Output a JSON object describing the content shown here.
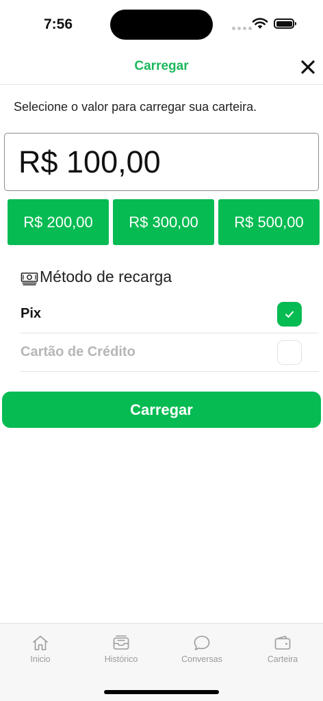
{
  "status_bar": {
    "time": "7:56"
  },
  "header": {
    "title": "Carregar",
    "close_icon": "close-x-icon"
  },
  "instruction": "Selecione o valor para carregar sua carteira.",
  "amount": {
    "value": "R$ 100,00"
  },
  "quick_amounts": [
    "R$ 200,00",
    "R$ 300,00",
    "R$ 500,00"
  ],
  "method": {
    "icon": "money-icon",
    "title": "Método de recarga",
    "options": [
      {
        "label": "Pix",
        "checked": true
      },
      {
        "label": "Cartão de Crédito",
        "checked": false
      }
    ]
  },
  "submit_label": "Carregar",
  "tabbar": {
    "tabs": [
      {
        "label": "Inicio",
        "icon": "home-icon"
      },
      {
        "label": "Histórico",
        "icon": "inbox-icon"
      },
      {
        "label": "Conversas",
        "icon": "chat-icon"
      },
      {
        "label": "Carteira",
        "icon": "wallet-icon"
      }
    ]
  },
  "colors": {
    "accent": "#06bb52",
    "title_green": "#1bb85c",
    "tab_inactive": "#9a9a9a"
  }
}
